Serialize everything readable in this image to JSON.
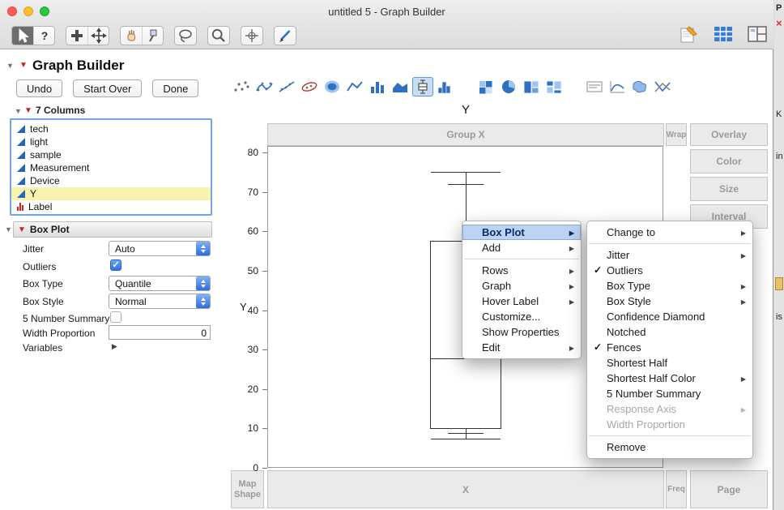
{
  "colors": {
    "accent_blue": "#2e6ce0",
    "selection_yellow": "#f8f4ae",
    "menu_highlight": "#bcd4f0",
    "zone_label_gray": "#9a9a9a",
    "traffic_red": "#ff5f57",
    "traffic_yellow": "#febc2e",
    "traffic_green": "#28c840"
  },
  "window": {
    "title": "untitled 5 - Graph Builder"
  },
  "toolbar": {
    "tool_groups": [
      [
        {
          "name": "cursor",
          "selected": true
        },
        {
          "name": "help"
        }
      ],
      [
        {
          "name": "selection"
        },
        {
          "name": "move"
        }
      ],
      [
        {
          "name": "grabber"
        },
        {
          "name": "brush"
        }
      ],
      [
        {
          "name": "lasso"
        }
      ],
      [
        {
          "name": "zoom"
        }
      ],
      [
        {
          "name": "crosshair"
        }
      ],
      [
        {
          "name": "annotate"
        }
      ]
    ],
    "right_icons": [
      "jmp-data-table",
      "data-grid",
      "window-layout"
    ]
  },
  "header": {
    "title": "Graph Builder",
    "undo": "Undo",
    "start_over": "Start Over",
    "done": "Done"
  },
  "palette": {
    "groups": [
      [
        {
          "name": "points"
        },
        {
          "name": "smoother"
        },
        {
          "name": "line-of-fit"
        },
        {
          "name": "ellipse"
        },
        {
          "name": "contour"
        },
        {
          "name": "line"
        },
        {
          "name": "bar"
        },
        {
          "name": "area"
        },
        {
          "name": "box-plot",
          "selected": true
        },
        {
          "name": "histogram"
        }
      ],
      [
        {
          "name": "heatmap"
        },
        {
          "name": "pie"
        },
        {
          "name": "treemap"
        },
        {
          "name": "mosaic"
        }
      ],
      [
        {
          "name": "caption-box"
        },
        {
          "name": "formula"
        },
        {
          "name": "map-shapes"
        },
        {
          "name": "parallel"
        }
      ]
    ]
  },
  "columns_panel": {
    "title": "7 Columns",
    "columns": [
      {
        "name": "tech",
        "type": "continuous"
      },
      {
        "name": "light",
        "type": "continuous"
      },
      {
        "name": "sample",
        "type": "continuous"
      },
      {
        "name": "Measurement",
        "type": "continuous"
      },
      {
        "name": "Device",
        "type": "continuous"
      },
      {
        "name": "Y",
        "type": "continuous",
        "selected": true
      },
      {
        "name": "Label",
        "type": "nominal"
      }
    ]
  },
  "element_panel": {
    "title": "Box Plot",
    "rows": [
      {
        "label": "Jitter",
        "control": "combo",
        "value": "Auto"
      },
      {
        "label": "Outliers",
        "control": "checkbox",
        "checked": true
      },
      {
        "label": "Box Type",
        "control": "combo",
        "value": "Quantile"
      },
      {
        "label": "Box Style",
        "control": "combo",
        "value": "Normal"
      },
      {
        "label": "5 Number Summary",
        "control": "checkbox",
        "checked": false
      },
      {
        "label": "Width Proportion",
        "control": "input",
        "value": "0"
      },
      {
        "label": "Variables",
        "control": "disclosure"
      }
    ]
  },
  "graph": {
    "title": "Y",
    "y_axis_label": "Y",
    "y_ticks": [
      80,
      70,
      60,
      50,
      40,
      30,
      20,
      10,
      0
    ],
    "zones": {
      "group_x": "Group X",
      "wrap": "Wrap",
      "overlay": "Overlay",
      "color": "Color",
      "size": "Size",
      "interval": "Interval",
      "map_shape": "Map Shape",
      "x": "X",
      "freq": "Freq",
      "page": "Page"
    },
    "box_plot": {
      "upper_fence": 75.3,
      "upper_cap": 72.2,
      "q3": 57.8,
      "median": 28.0,
      "q1": 10.1,
      "lower_cap": 9.0,
      "lower_fence": 7.6
    }
  },
  "context_menu": {
    "items": [
      {
        "label": "Box Plot",
        "arrow": true,
        "highlighted": true
      },
      {
        "label": "Add",
        "arrow": true
      },
      {
        "separator": true
      },
      {
        "label": "Rows",
        "arrow": true
      },
      {
        "label": "Graph",
        "arrow": true
      },
      {
        "label": "Hover Label",
        "arrow": true
      },
      {
        "label": "Customize..."
      },
      {
        "label": "Show Properties"
      },
      {
        "label": "Edit",
        "arrow": true
      }
    ]
  },
  "submenu": {
    "items": [
      {
        "label": "Change to",
        "arrow": true
      },
      {
        "separator": true
      },
      {
        "label": "Jitter",
        "arrow": true
      },
      {
        "label": "Outliers",
        "checked": true
      },
      {
        "label": "Box Type",
        "arrow": true
      },
      {
        "label": "Box Style",
        "arrow": true
      },
      {
        "label": "Confidence Diamond"
      },
      {
        "label": "Notched"
      },
      {
        "label": "Fences",
        "checked": true
      },
      {
        "label": "Shortest Half"
      },
      {
        "label": "Shortest Half Color",
        "arrow": true
      },
      {
        "label": "5 Number Summary"
      },
      {
        "label": "Response Axis",
        "arrow": true,
        "disabled": true
      },
      {
        "label": "Width Proportion",
        "disabled": true
      },
      {
        "separator": true
      },
      {
        "label": "Remove"
      }
    ]
  },
  "right_edge": {
    "fragments": [
      "P",
      "×",
      "K",
      "in",
      "is"
    ]
  }
}
